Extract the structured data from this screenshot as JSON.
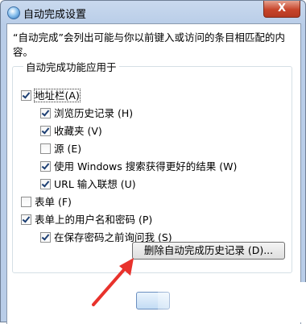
{
  "window": {
    "title": "自动完成设置",
    "close_glyph": "X"
  },
  "description": "“自动完成”会列出可能与你以前键入或访问的条目相匹配的内容。",
  "group": {
    "legend": "自动完成功能应用于",
    "address_bar": {
      "label": "地址栏",
      "accel": "(A)",
      "checked": true
    },
    "sub_items": [
      {
        "label": "浏览历史记录 (H)",
        "checked": true
      },
      {
        "label": "收藏夹 (V)",
        "checked": true
      },
      {
        "label": "源 (E)",
        "checked": false
      },
      {
        "label": "使用 Windows 搜索获得更好的结果 (W)",
        "checked": true
      },
      {
        "label": "URL 输入联想 (U)",
        "checked": true
      }
    ],
    "forms": {
      "label": "表单 (F)",
      "checked": false
    },
    "usernames_passwords": {
      "label": "表单上的用户名和密码 (P)",
      "checked": true
    },
    "ask_before_save": {
      "label": "在保存密码之前询问我 (S)",
      "checked": true
    }
  },
  "delete_button_label": "删除自动完成历史记录 (D)...",
  "colors": {
    "arrow": "#e8322c",
    "accent": "#1d3f73"
  }
}
